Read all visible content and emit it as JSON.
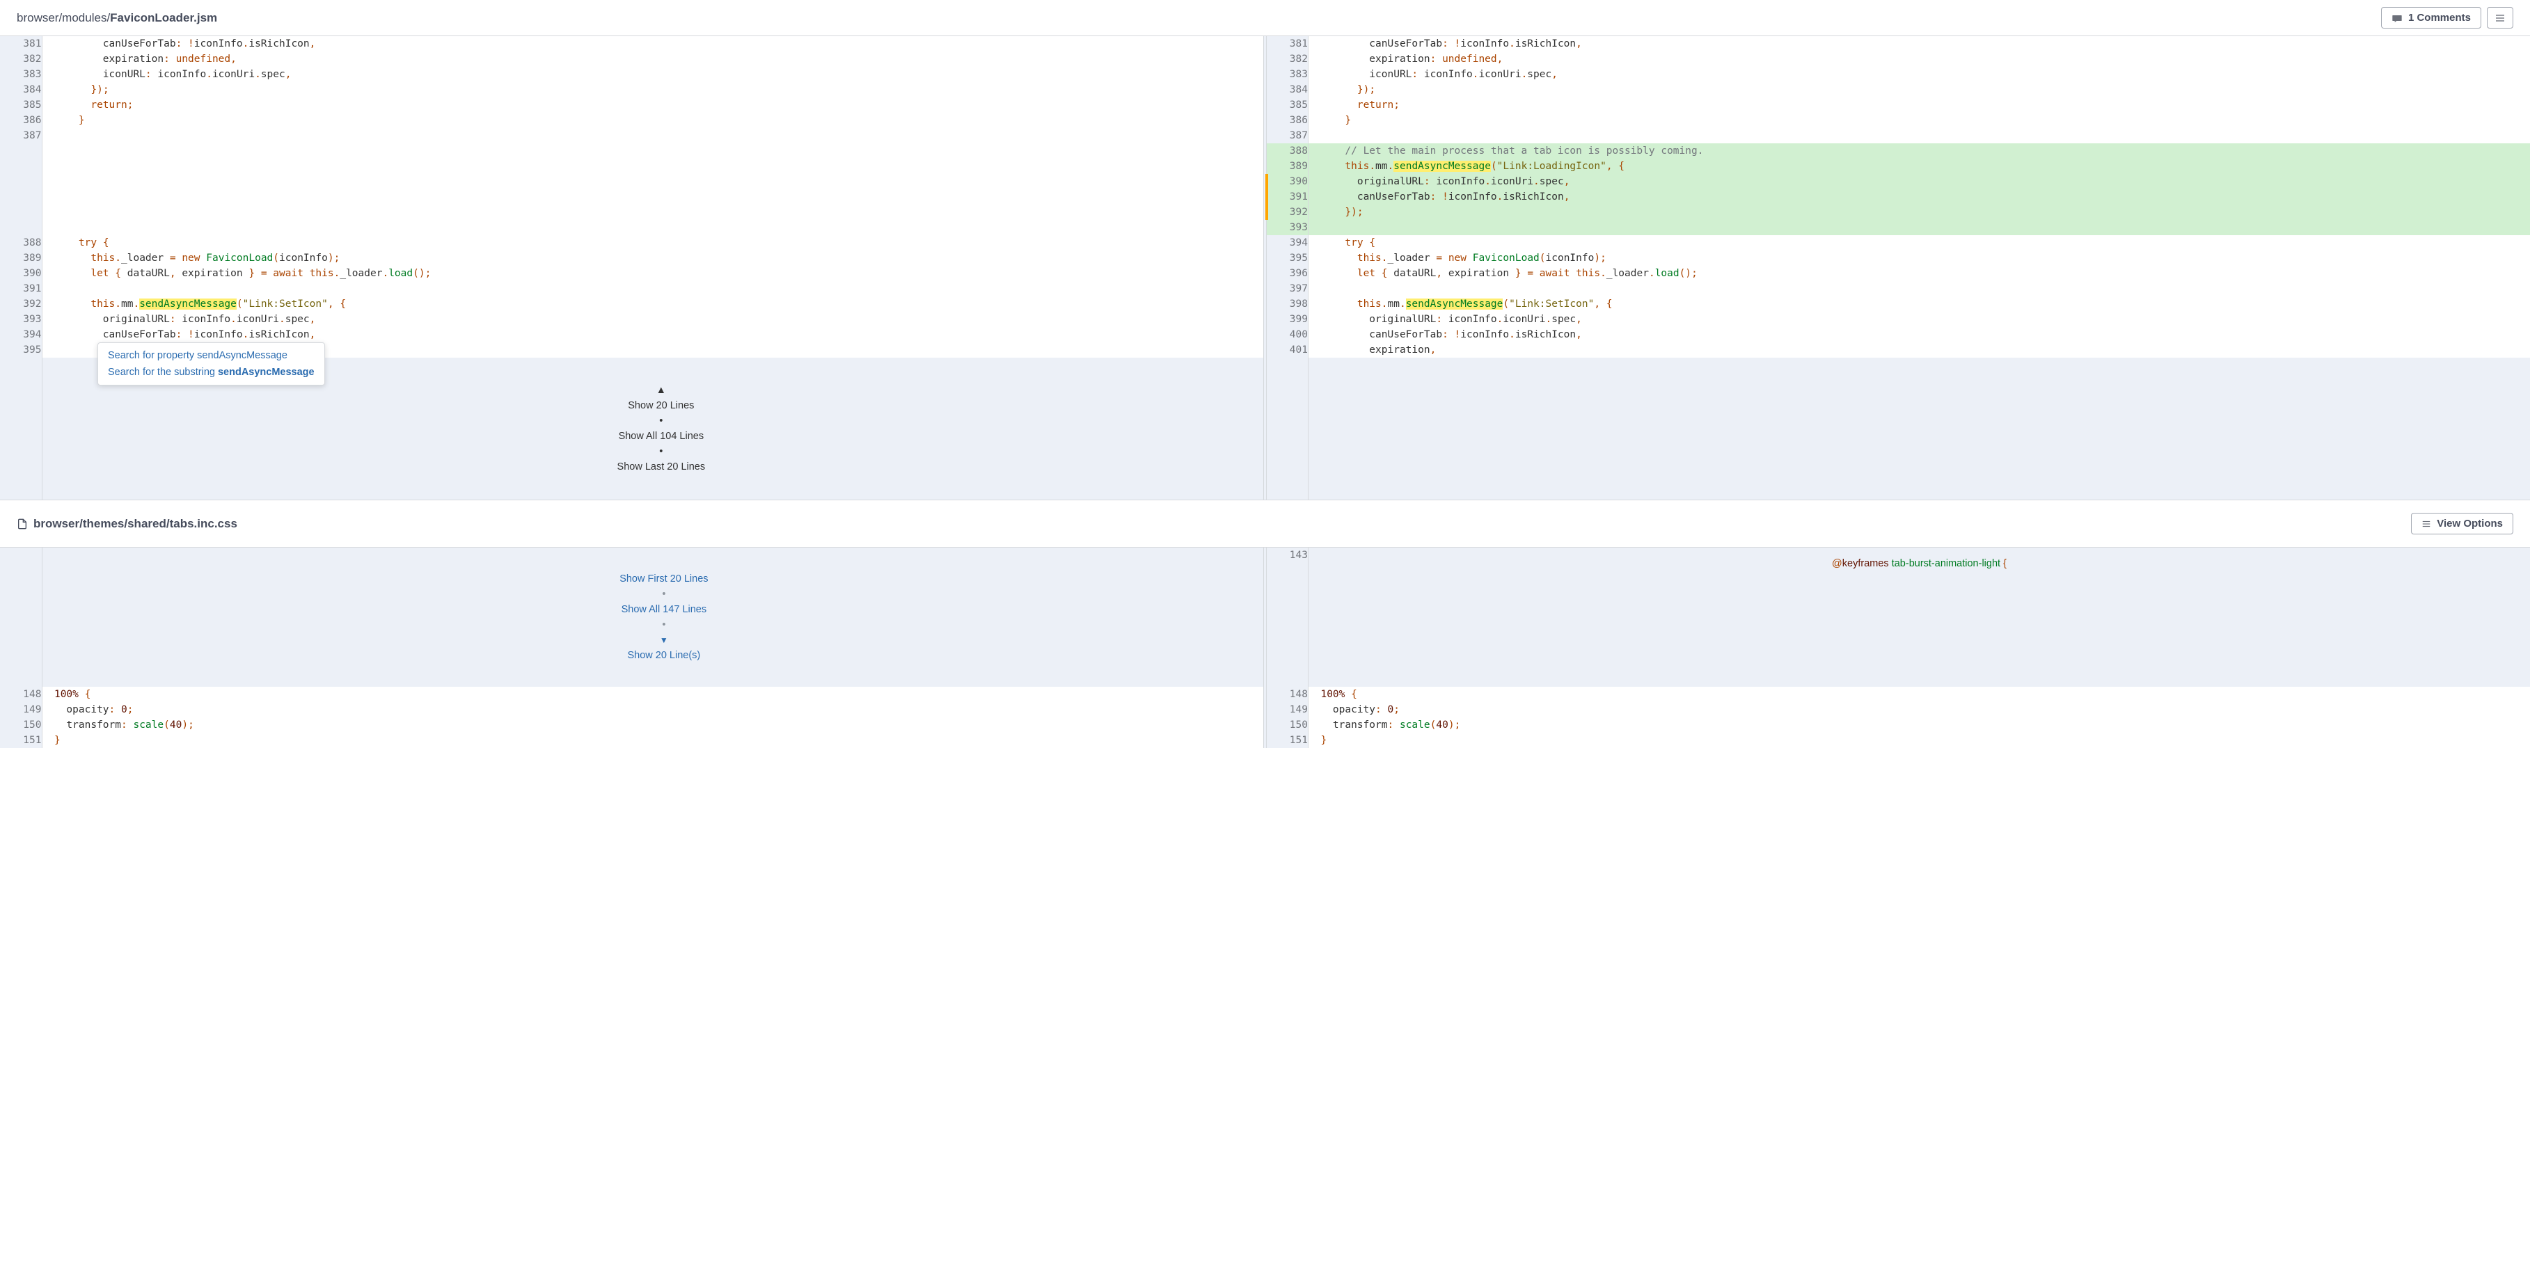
{
  "header": {
    "breadcrumb_prefix": "browser/modules/",
    "breadcrumb_file": "FaviconLoader.jsm",
    "comments_label": "1 Comments"
  },
  "context_menu": {
    "item1_prefix": "Search for property ",
    "item1_term": "sendAsyncMessage",
    "item2_prefix": "Search for the substring ",
    "item2_term": "sendAsyncMessage"
  },
  "show_bar1": {
    "show20": "Show 20 Lines",
    "showAll": "Show All 104 Lines",
    "showLast": "Show Last 20 Lines"
  },
  "file2": {
    "path": "browser/themes/shared/tabs.inc.css",
    "view_options": "View Options"
  },
  "show_bar2": {
    "showFirst": "Show First 20 Lines",
    "showAll": "Show All 147 Lines",
    "show20": "Show 20 Line(s)"
  },
  "diff_left": [
    {
      "n": "381",
      "html": "          canUseForTab<span class='k'>:</span> <span class='k'>!</span>iconInfo<span class='k'>.</span>isRichIcon<span class='k'>,</span>"
    },
    {
      "n": "382",
      "html": "          expiration<span class='k'>:</span> <span class='k'>undefined</span><span class='k'>,</span>"
    },
    {
      "n": "383",
      "html": "          iconURL<span class='k'>:</span> iconInfo<span class='k'>.</span>iconUri<span class='k'>.</span>spec<span class='k'>,</span>"
    },
    {
      "n": "384",
      "html": "        <span class='k'>}</span><span class='k'>)</span><span class='k'>;</span>"
    },
    {
      "n": "385",
      "html": "        <span class='k'>return</span><span class='k'>;</span>"
    },
    {
      "n": "386",
      "html": "      <span class='k'>}</span>"
    },
    {
      "n": "387",
      "html": ""
    },
    {
      "n": "",
      "html": ""
    },
    {
      "n": "",
      "html": ""
    },
    {
      "n": "",
      "html": ""
    },
    {
      "n": "",
      "html": ""
    },
    {
      "n": "",
      "html": ""
    },
    {
      "n": "",
      "html": ""
    },
    {
      "n": "388",
      "html": "      <span class='k'>try</span> <span class='k'>{</span>"
    },
    {
      "n": "389",
      "html": "        <span class='this'>this</span><span class='k'>.</span>_loader <span class='k'>=</span> <span class='k'>new</span> <span class='v'>FaviconLoad</span><span class='k'>(</span>iconInfo<span class='k'>)</span><span class='k'>;</span>"
    },
    {
      "n": "390",
      "html": "        <span class='k'>let</span> <span class='k'>{</span> dataURL<span class='k'>,</span> expiration <span class='k'>}</span> <span class='k'>=</span> <span class='k'>await</span> <span class='this'>this</span><span class='k'>.</span>_loader<span class='k'>.</span><span class='v'>load</span><span class='k'>(</span><span class='k'>)</span><span class='k'>;</span>"
    },
    {
      "n": "391",
      "html": ""
    },
    {
      "n": "392",
      "html": "        <span class='this'>this</span><span class='k'>.</span>mm<span class='k'>.</span><span class='hl-yellow v'>sendAsyncMessage</span><span class='k'>(</span><span class='s'>\"Link:SetIcon\"</span><span class='k'>,</span> <span class='k'>{</span>"
    },
    {
      "n": "393",
      "html": "          originalURL<span class='k'>:</span> iconInfo<span class='k'>.</span>iconUri<span class='k'>.</span>spec<span class='k'>,</span>"
    },
    {
      "n": "394",
      "html": "          canUseForTab<span class='k'>:</span> <span class='k'>!</span>iconInfo<span class='k'>.</span>isRichIcon<span class='k'>,</span>"
    },
    {
      "n": "395",
      "html": "          expiration<span class='k'>,</span>"
    }
  ],
  "diff_right": [
    {
      "n": "381",
      "html": "          canUseForTab<span class='k'>:</span> <span class='k'>!</span>iconInfo<span class='k'>.</span>isRichIcon<span class='k'>,</span>",
      "cls": ""
    },
    {
      "n": "382",
      "html": "          expiration<span class='k'>:</span> <span class='k'>undefined</span><span class='k'>,</span>",
      "cls": ""
    },
    {
      "n": "383",
      "html": "          iconURL<span class='k'>:</span> iconInfo<span class='k'>.</span>iconUri<span class='k'>.</span>spec<span class='k'>,</span>",
      "cls": ""
    },
    {
      "n": "384",
      "html": "        <span class='k'>}</span><span class='k'>)</span><span class='k'>;</span>",
      "cls": ""
    },
    {
      "n": "385",
      "html": "        <span class='k'>return</span><span class='k'>;</span>",
      "cls": ""
    },
    {
      "n": "386",
      "html": "      <span class='k'>}</span>",
      "cls": ""
    },
    {
      "n": "387",
      "html": "",
      "cls": ""
    },
    {
      "n": "388",
      "html": "      <span class='c'>// Let the main process that a tab icon is possibly coming.</span>",
      "cls": "added"
    },
    {
      "n": "389",
      "html": "      <span class='this'>this</span><span class='k'>.</span>mm<span class='k'>.</span><span class='hl-yellow v'>sendAsyncMessage</span><span class='k'>(</span><span class='s'>\"Link:LoadingIcon\"</span><span class='k'>,</span> <span class='k'>{</span>",
      "cls": "added"
    },
    {
      "n": "390",
      "html": "        originalURL<span class='k'>:</span> iconInfo<span class='k'>.</span>iconUri<span class='k'>.</span>spec<span class='k'>,</span>",
      "cls": "added strip"
    },
    {
      "n": "391",
      "html": "        canUseForTab<span class='k'>:</span> <span class='k'>!</span>iconInfo<span class='k'>.</span>isRichIcon<span class='k'>,</span>",
      "cls": "added strip"
    },
    {
      "n": "392",
      "html": "      <span class='k'>}</span><span class='k'>)</span><span class='k'>;</span>",
      "cls": "added strip"
    },
    {
      "n": "393",
      "html": "",
      "cls": "added"
    },
    {
      "n": "394",
      "html": "      <span class='k'>try</span> <span class='k'>{</span>",
      "cls": ""
    },
    {
      "n": "395",
      "html": "        <span class='this'>this</span><span class='k'>.</span>_loader <span class='k'>=</span> <span class='k'>new</span> <span class='v'>FaviconLoad</span><span class='k'>(</span>iconInfo<span class='k'>)</span><span class='k'>;</span>",
      "cls": ""
    },
    {
      "n": "396",
      "html": "        <span class='k'>let</span> <span class='k'>{</span> dataURL<span class='k'>,</span> expiration <span class='k'>}</span> <span class='k'>=</span> <span class='k'>await</span> <span class='this'>this</span><span class='k'>.</span>_loader<span class='k'>.</span><span class='v'>load</span><span class='k'>(</span><span class='k'>)</span><span class='k'>;</span>",
      "cls": ""
    },
    {
      "n": "397",
      "html": "",
      "cls": ""
    },
    {
      "n": "398",
      "html": "        <span class='this'>this</span><span class='k'>.</span>mm<span class='k'>.</span><span class='hl-yellow v'>sendAsyncMessage</span><span class='k'>(</span><span class='s'>\"Link:SetIcon\"</span><span class='k'>,</span> <span class='k'>{</span>",
      "cls": ""
    },
    {
      "n": "399",
      "html": "          originalURL<span class='k'>:</span> iconInfo<span class='k'>.</span>iconUri<span class='k'>.</span>spec<span class='k'>,</span>",
      "cls": ""
    },
    {
      "n": "400",
      "html": "          canUseForTab<span class='k'>:</span> <span class='k'>!</span>iconInfo<span class='k'>.</span>isRichIcon<span class='k'>,</span>",
      "cls": ""
    },
    {
      "n": "401",
      "html": "          expiration<span class='k'>,</span>",
      "cls": ""
    }
  ],
  "css_keyframe_line": {
    "n": "143",
    "html": "<span class='k'>@</span><span style='color:#601200'>keyframes</span> <span class='v'>tab-burst-animation-light</span> <span class='k'>{</span>"
  },
  "css_lines": [
    {
      "n": "148",
      "html": "  <span class='num'>100%</span> <span class='k'>{</span>"
    },
    {
      "n": "149",
      "html": "    opacity<span class='k'>:</span> <span class='num'>0</span><span class='k'>;</span>"
    },
    {
      "n": "150",
      "html": "    transform<span class='k'>:</span> <span class='v'>scale</span><span class='k'>(</span><span class='num'>40</span><span class='k'>)</span><span class='k'>;</span>"
    },
    {
      "n": "151",
      "html": "  <span class='k'>}</span>"
    }
  ]
}
